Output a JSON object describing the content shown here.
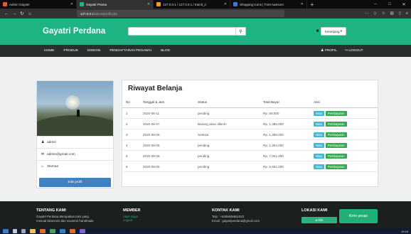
{
  "browser": {
    "tabs": [
      {
        "label": "Admin Gayatri",
        "active": false,
        "favicon_color": "#e8562e"
      },
      {
        "label": "Gayatri Prama",
        "active": true,
        "favicon_color": ""
      },
      {
        "label": "127.0.0.1 / 127.0.0.1 / trainit_ri",
        "active": false,
        "favicon_color": "#f59b18"
      },
      {
        "label": "Shopping Icons | Font Awesom",
        "active": false,
        "favicon_color": "#3b7bd6"
      }
    ],
    "url_host": "127.0.0.1",
    "url_path": "/rancis/profil.php"
  },
  "header": {
    "brand": "Gayatri Perdana",
    "search_placeholder": "",
    "cart_label": "Keranjang"
  },
  "nav": {
    "items": [
      "HOME",
      "PRODUK",
      "DISKON",
      "PENDAFTARAN PEGAWAI",
      "BLOG"
    ],
    "profil": "PROFIL",
    "logout": "LOGOUT"
  },
  "profile": {
    "name": "admin",
    "email": "admin@gmail.com",
    "city": "Sleman",
    "edit_label": "Edit profil"
  },
  "history": {
    "title": "Riwayat Belanja",
    "columns": [
      "No",
      "Tanggal & Jam",
      "Status",
      "Total Bayar",
      "Aksi"
    ],
    "nota_label": "Nota",
    "bayar_label": "Pembayaran",
    "rows": [
      {
        "no": "1",
        "date": "2020-08-11",
        "status": "pending",
        "total": "Rp. 58,000"
      },
      {
        "no": "2",
        "date": "2020-08-07",
        "status": "Barang akan dikirim",
        "total": "Rp. 1,386,000"
      },
      {
        "no": "3",
        "date": "2020-08-05",
        "status": "Selesai",
        "total": "Rp. 1,389,000"
      },
      {
        "no": "4",
        "date": "2020-08-05",
        "status": "pending",
        "total": "Rp. 1,364,000"
      },
      {
        "no": "5",
        "date": "2020-08-05",
        "status": "pending",
        "total": "Rp. 7,001,000"
      },
      {
        "no": "6",
        "date": "2020-08-05",
        "status": "pending",
        "total": "Rp. 5,561,000"
      }
    ]
  },
  "footer": {
    "tentang_head": "TENTANG KAMI",
    "tentang_text_1": "Gayatri Perdana Merupakan toko yang",
    "tentang_text_2": "menual aksesoris dan souvenir handmade",
    "member_head": "MEMBER",
    "member_link_1": "Akun Saya",
    "member_link_2": "Logout",
    "kontak_head": "KONTAK KAMI",
    "kontak_tel": "Telp : +6289608601043",
    "kontak_email": "Email : gayatriperdana@gmail.com",
    "lokasi_head": "LOKASI KAMI",
    "map_btn": "Klik",
    "chat_label": "Kirim pesan"
  },
  "taskbar": {
    "tray_time": "19:16"
  },
  "colors": {
    "brand_green": "#1db383",
    "nav_dark": "#2a2f2d",
    "edit_blue": "#3d82c4",
    "nota_cyan": "#41b8d6",
    "bayar_green": "#36a852"
  }
}
